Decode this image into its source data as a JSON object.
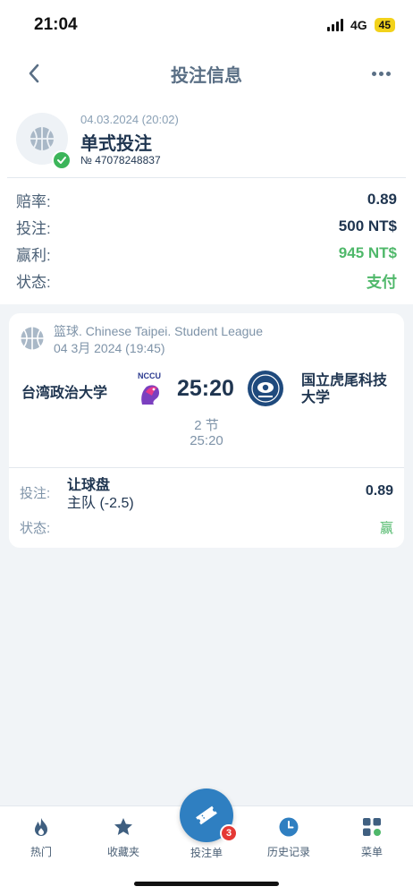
{
  "status_bar": {
    "time": "21:04",
    "network": "4G",
    "battery": "45"
  },
  "header": {
    "title": "投注信息"
  },
  "bet": {
    "date": "04.03.2024 (20:02)",
    "type": "单式投注",
    "number": "№ 47078248837",
    "rows": [
      {
        "label": "赔率:",
        "value": "0.89"
      },
      {
        "label": "投注:",
        "value": "500 NT$"
      },
      {
        "label": "赢利:",
        "value": "945 NT$"
      },
      {
        "label": "状态:",
        "value": "支付"
      }
    ]
  },
  "event": {
    "league": "篮球. Chinese Taipei. Student League",
    "date": "04 3月 2024 (19:45)",
    "home_team": "台湾政治大学",
    "home_logo_text": "NCCU",
    "away_team": "国立虎尾科技大学",
    "score": "25:20",
    "period": "2 节",
    "period_score": "25:20",
    "pick_label": "投注:",
    "pick_market": "让球盘",
    "pick_selection": "主队 (-2.5)",
    "pick_odds": "0.89",
    "result_label": "状态:",
    "result_value": "赢"
  },
  "tabbar": {
    "tabs": [
      {
        "label": "热门",
        "icon": "flame-icon"
      },
      {
        "label": "收藏夹",
        "icon": "star-icon"
      },
      {
        "label": "投注单",
        "icon": "ticket-icon",
        "badge": "3"
      },
      {
        "label": "历史记录",
        "icon": "clock-icon"
      },
      {
        "label": "菜单",
        "icon": "grid-icon"
      }
    ]
  },
  "colors": {
    "accent": "#2f7fc1",
    "win": "#4fb86a",
    "title": "#5a6f85",
    "badge": "#e53935"
  }
}
